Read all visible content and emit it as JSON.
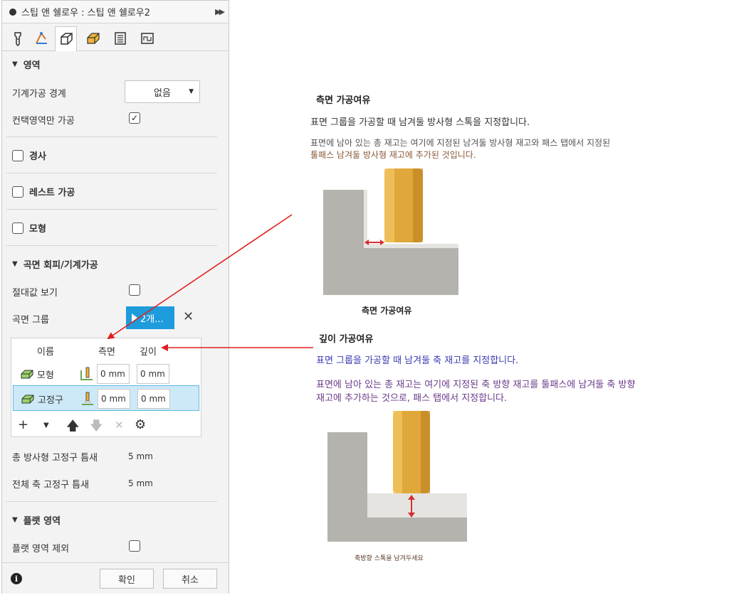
{
  "panel": {
    "title": "스팁 앤 쉘로우 : 스팁 앤 쉘로우2",
    "tabs": [
      "tool-icon",
      "geometry-icon",
      "heights-icon",
      "passes-icon",
      "linking-icon",
      "feeds-icon"
    ],
    "sections": {
      "area": {
        "header": "영역",
        "machining_boundary_label": "기계가공 경계",
        "machining_boundary_value": "없음",
        "contact_only_label": "컨택영역만 가공",
        "contact_only_checked": true
      },
      "slope": {
        "header": "경사"
      },
      "rest": {
        "header": "레스트 가공"
      },
      "model": {
        "header": "모형"
      },
      "avoid": {
        "header": "곡면 회피/기계가공",
        "show_absolute_label": "절대값 보기",
        "surface_group_label": "곡면 그룹",
        "surface_group_button": "2개...",
        "table": {
          "headers": [
            "이름",
            "측면",
            "깊이"
          ],
          "rows": [
            {
              "name": "모형",
              "radial": "0 mm",
              "axial": "0 mm",
              "selected": false
            },
            {
              "name": "고정구",
              "radial": "0 mm",
              "axial": "0 mm",
              "selected": true
            }
          ]
        },
        "total_radial_label": "총 방사형 고정구 틈새",
        "total_radial_value": "5 mm",
        "total_axial_label": "전체 축 고정구 틈새",
        "total_axial_value": "5 mm"
      },
      "flat": {
        "header": "플랫 영역",
        "exclude_label": "플랫 영역 제외"
      }
    },
    "buttons": {
      "ok": "확인",
      "cancel": "취소"
    }
  },
  "help": {
    "radial": {
      "title": "측면 가공여유",
      "desc1": "표면 그룹을 가공할 때 남겨둘 방사형 스톡을 지정합니다.",
      "desc2a": "표면에 남아 있는 총 재고는 여기에 지정된 남겨둘 방사형 재고와 패스 탭에서 지정된",
      "desc2b": "툴패스 남겨둘 방사형 재고에 추가된 것입니다.",
      "caption": "측면 가공여유"
    },
    "axial": {
      "title": "깊이 가공여유",
      "desc1": "표면 그룹을 가공할 때 남겨둘 축 재고를 지정합니다.",
      "desc2a": "표면에 남아 있는 총 재고는 여기에 지정된 축 방향 재고를 툴패스에 남겨둘 축 방향",
      "desc2b": "재고에 추가하는 것으로, 패스 탭에서 지정합니다.",
      "caption": "축방향 스톡을 남겨두세요"
    }
  },
  "colors": {
    "accent": "#1e9bdc",
    "arrow": "#e02020",
    "axial_text": "#3a3ab0",
    "radial_text_brown": "#8a5a3a"
  }
}
